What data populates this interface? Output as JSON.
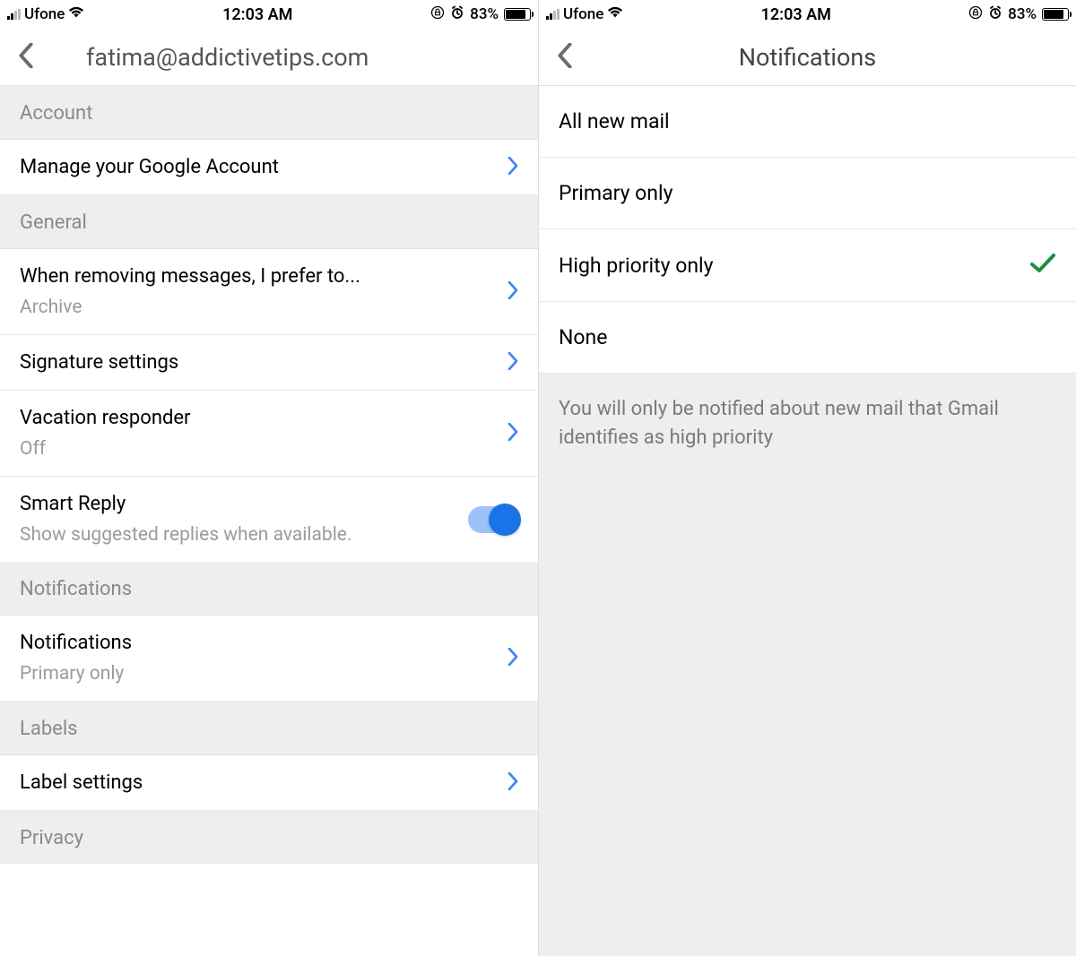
{
  "statusBar": {
    "carrier": "Ufone",
    "time": "12:03 AM",
    "batteryPercent": "83%"
  },
  "left": {
    "title": "fatima@addictivetips.com",
    "sections": {
      "account": {
        "header": "Account",
        "manage": "Manage your Google Account"
      },
      "general": {
        "header": "General",
        "removing": {
          "title": "When removing messages, I prefer to...",
          "value": "Archive"
        },
        "signature": "Signature settings",
        "vacation": {
          "title": "Vacation responder",
          "value": "Off"
        },
        "smartReply": {
          "title": "Smart Reply",
          "sub": "Show suggested replies when available.",
          "on": true
        }
      },
      "notifications": {
        "header": "Notifications",
        "row": {
          "title": "Notifications",
          "value": "Primary only"
        }
      },
      "labels": {
        "header": "Labels",
        "row": "Label settings"
      },
      "privacy": {
        "header": "Privacy"
      }
    }
  },
  "right": {
    "title": "Notifications",
    "options": [
      {
        "label": "All new mail",
        "selected": false
      },
      {
        "label": "Primary only",
        "selected": false
      },
      {
        "label": "High priority only",
        "selected": true
      },
      {
        "label": "None",
        "selected": false
      }
    ],
    "footer": "You will only be notified about new mail that Gmail identifies as high priority"
  }
}
